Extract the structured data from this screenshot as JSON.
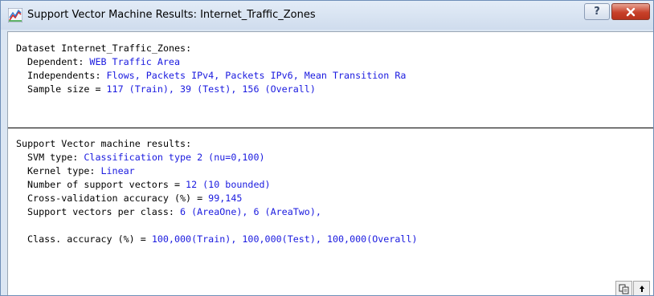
{
  "window": {
    "title": "Support Vector Machine Results: Internet_Traffic_Zones",
    "help_label": "?",
    "close_label": "x"
  },
  "dataset": {
    "header": "Dataset Internet_Traffic_Zones:",
    "dependent_label": "Dependent: ",
    "dependent_value": "WEB Traffic Area",
    "independents_label": "Independents: ",
    "independents_value": "Flows, Packets IPv4, Packets IPv6, Mean Transition Ra",
    "sample_label": "Sample size = ",
    "sample_value": "117 (Train), 39 (Test), 156 (Overall)"
  },
  "results": {
    "header": "Support Vector machine results:",
    "svm_type_label": "SVM type: ",
    "svm_type_value": "Classification type 2 (nu=0,100)",
    "kernel_label": "Kernel type: ",
    "kernel_value": "Linear",
    "support_vectors_label": "Number of support vectors = ",
    "support_vectors_value": "12 (10 bounded)",
    "cv_label": "Cross-validation accuracy (%) = ",
    "cv_value": "99,145",
    "per_class_label": "Support vectors per class: ",
    "per_class_value": "6 (AreaOne), 6 (AreaTwo),",
    "class_acc_label": "Class. accuracy (%) = ",
    "class_acc_value": "100,000(Train), 100,000(Test), 100,000(Overall)"
  },
  "toolbar": {
    "copy_icon": "copy-icon",
    "scroll_top_icon": "scroll-top-icon"
  }
}
